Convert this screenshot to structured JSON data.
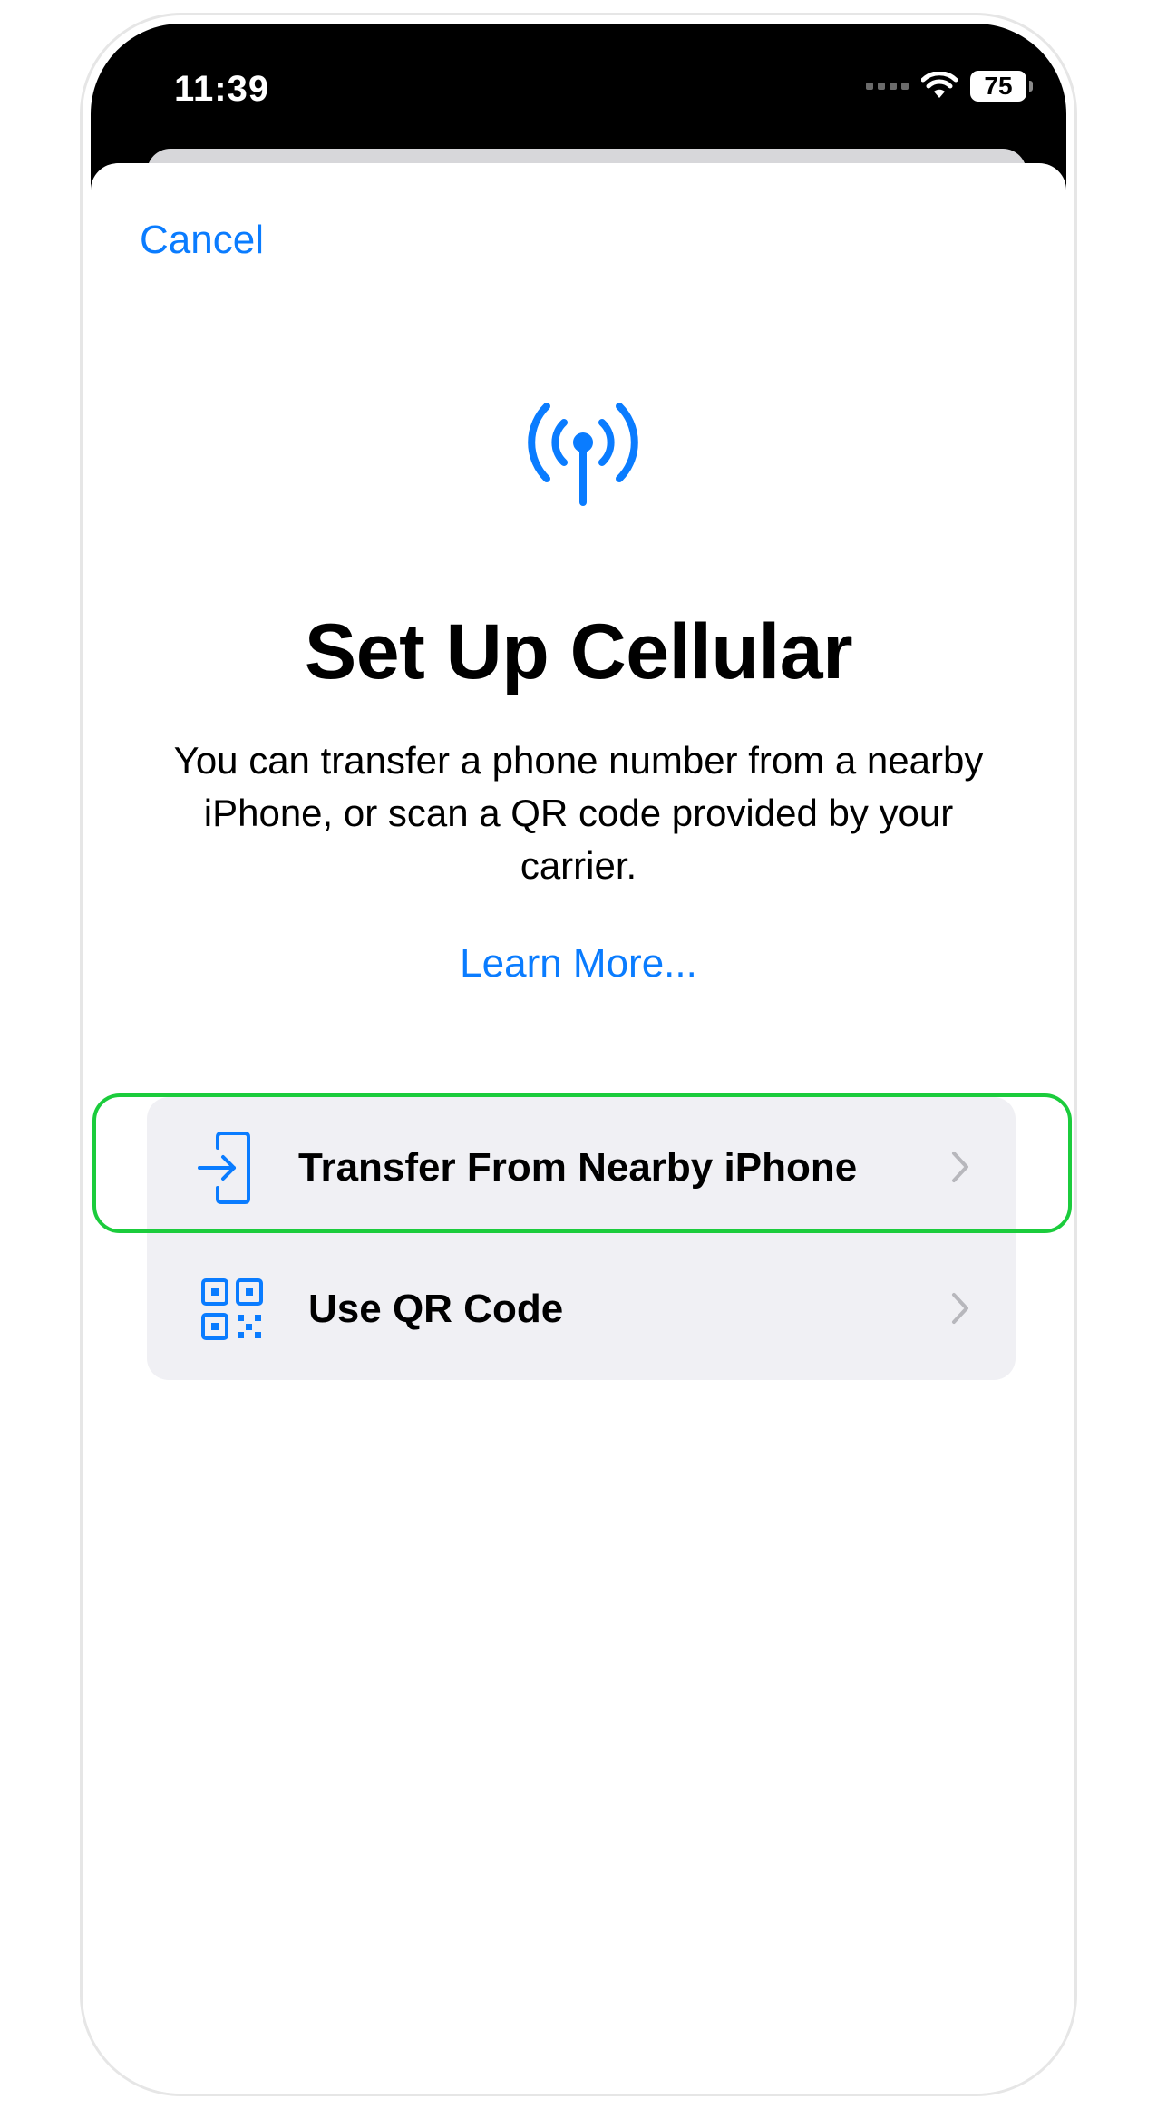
{
  "status_bar": {
    "time": "11:39",
    "battery": "75",
    "signal_icon": "cellular-signal-dots-icon",
    "wifi_icon": "wifi-icon"
  },
  "nav": {
    "cancel_label": "Cancel"
  },
  "hero": {
    "icon": "antenna-radiowaves-icon",
    "title": "Set Up Cellular",
    "description": "You can transfer a phone number from a nearby iPhone, or scan a QR code provided by your carrier.",
    "learn_more": "Learn More..."
  },
  "options": [
    {
      "label": "Transfer From Nearby iPhone",
      "icon": "transfer-to-phone-icon"
    },
    {
      "label": "Use QR Code",
      "icon": "qr-code-icon"
    }
  ],
  "colors": {
    "accent": "#0a7cff",
    "highlight": "#1bcc3c",
    "group_background": "#f0f0f4"
  }
}
